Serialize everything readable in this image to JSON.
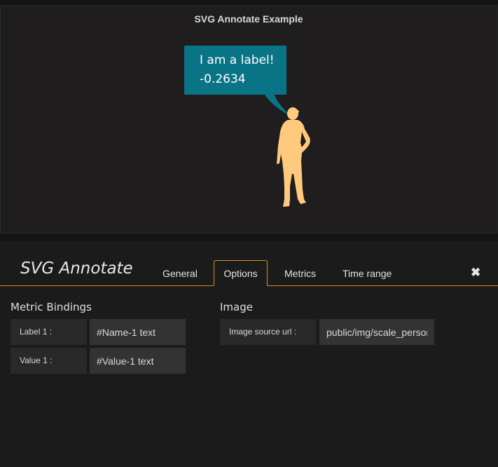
{
  "panel": {
    "title": "SVG Annotate Example",
    "label_text": "I am a label!",
    "value_text": "-0.2634"
  },
  "editor": {
    "title": "SVG Annotate",
    "tabs": [
      "General",
      "Options",
      "Metrics",
      "Time range"
    ],
    "active_tab": "Options",
    "close_icon": "close-icon"
  },
  "options": {
    "metric_bindings": {
      "heading": "Metric Bindings",
      "rows": [
        {
          "label": "Label 1 :",
          "value": "#Name-1 text"
        },
        {
          "label": "Value 1 :",
          "value": "#Value-1 text"
        }
      ]
    },
    "image": {
      "heading": "Image",
      "source_label": "Image source url :",
      "source_value": "public/img/scale_person.svg"
    }
  },
  "colors": {
    "accent": "#e28a1f",
    "label_box": "#0a7487",
    "figure": "#ffc97e"
  }
}
